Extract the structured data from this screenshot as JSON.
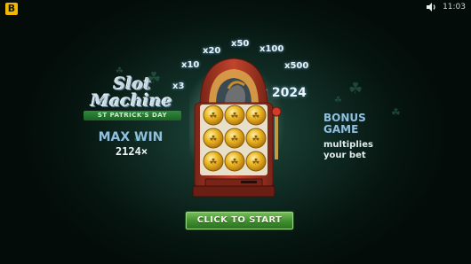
{
  "brand": {
    "logo_letter": "B"
  },
  "status": {
    "time": "11:03"
  },
  "game_title": {
    "line1": "Slot",
    "line2": "Machine",
    "subtitle": "ST PATRICK'S DAY"
  },
  "max_win": {
    "label": "MAX WIN",
    "value": "2124×"
  },
  "bonus": {
    "line1": "BONUS",
    "line2": "GAME",
    "line3": "multiplies",
    "line4": "your bet"
  },
  "multipliers": [
    "x3",
    "x10",
    "x20",
    "x50",
    "x100",
    "x500",
    "x 2024"
  ],
  "reels": {
    "symbols": [
      "coin",
      "coin",
      "coin",
      "coin",
      "coin",
      "coin",
      "coin",
      "coin",
      "coin"
    ]
  },
  "start_button": {
    "label": "CLICK TO START"
  },
  "colors": {
    "accent_blue": "#8fc1de",
    "button_green": "#3e8e2e",
    "machine_red": "#b33a26",
    "coin_gold": "#e0a81a",
    "brand_yellow": "#f2b800"
  },
  "icons": [
    "brand-logo-icon",
    "speaker-icon",
    "clover-icon",
    "coin-icon",
    "lever-icon"
  ]
}
